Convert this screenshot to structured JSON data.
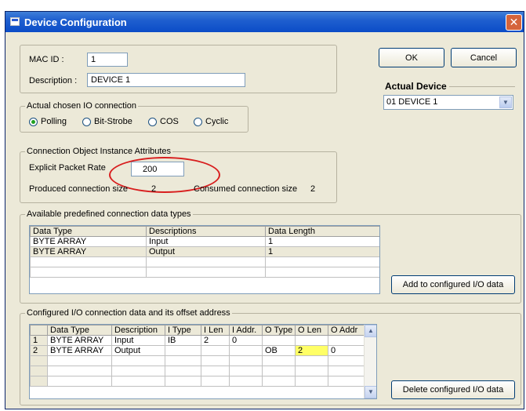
{
  "window": {
    "title": "Device Configuration",
    "close_glyph": "✕"
  },
  "device": {
    "mac_id_label": "MAC ID :",
    "mac_id_value": "1",
    "description_label": "Description :",
    "description_value": "DEVICE 1"
  },
  "buttons": {
    "ok": "OK",
    "cancel": "Cancel",
    "add_configured": "Add to configured I/O data",
    "delete_configured": "Delete configured I/O data"
  },
  "actual_device": {
    "legend": "Actual Device",
    "selected": "01  DEVICE 1"
  },
  "io_connection": {
    "legend": "Actual chosen IO connection",
    "options": [
      "Polling",
      "Bit-Strobe",
      "COS",
      "Cyclic"
    ],
    "selected_index": 0
  },
  "attributes": {
    "legend": "Connection Object Instance Attributes",
    "explicit_packet_rate_label": "Explicit Packet Rate",
    "explicit_packet_rate_value": "200",
    "produced_label": "Produced connection size",
    "produced_value": "2",
    "consumed_label": "Consumed connection size",
    "consumed_value": "2"
  },
  "available": {
    "legend": "Available predefined connection data types",
    "columns": [
      "Data Type",
      "Descriptions",
      "Data Length"
    ],
    "rows": [
      [
        "BYTE ARRAY",
        "Input",
        "1"
      ],
      [
        "BYTE ARRAY",
        "Output",
        "1"
      ]
    ]
  },
  "configured": {
    "legend": "Configured I/O connection data and its offset address",
    "columns": [
      "",
      "Data Type",
      "Description",
      "I Type",
      "I Len",
      "I Addr.",
      "O Type",
      "O Len",
      "O Addr"
    ],
    "rows": [
      [
        "1",
        "BYTE ARRAY",
        "Input",
        "IB",
        "2",
        "0",
        "",
        "",
        ""
      ],
      [
        "2",
        "BYTE ARRAY",
        "Output",
        "",
        "",
        "",
        "OB",
        "2",
        "0"
      ]
    ],
    "highlight_color": "#ffff66"
  },
  "icons": {
    "scroll_up": "▲",
    "scroll_down": "▼",
    "dropdown": "▼"
  }
}
